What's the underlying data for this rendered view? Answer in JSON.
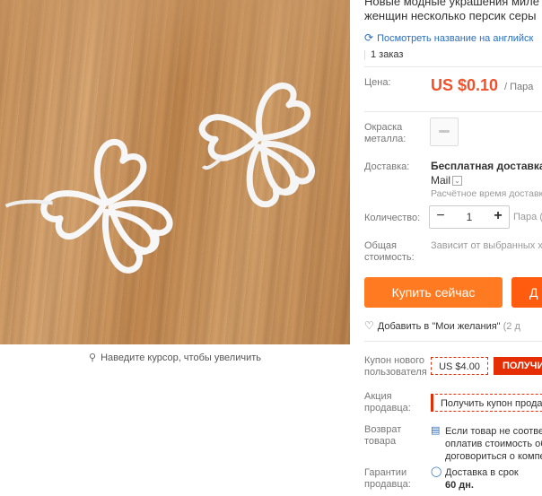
{
  "product": {
    "title_line1": "Новые модные украшения миле",
    "title_line2": "женщин несколько персик серы",
    "translate_link": "Посмотреть название на английск",
    "orders": "1 заказ"
  },
  "image": {
    "zoom_hint": "Наведите курсор, чтобы увеличить"
  },
  "price": {
    "label": "Цена:",
    "value": "US $0.10",
    "unit": "/ Пара"
  },
  "color": {
    "label_line1": "Окраска",
    "label_line2": "металла:"
  },
  "shipping": {
    "label": "Доставка:",
    "main": "Бесплатная доставка в",
    "method": "Mail",
    "estimate": "Расчётное время доставк"
  },
  "quantity": {
    "label": "Количество:",
    "minus": "−",
    "value": "1",
    "plus": "+",
    "unit": "Пара (",
    "aria": ""
  },
  "total": {
    "label_line1": "Общая",
    "label_line2": "стоимость:",
    "value": "Зависит от выбранных ха"
  },
  "actions": {
    "buy": "Купить сейчас",
    "cart": "Д"
  },
  "wishlist": {
    "text": "Добавить в \"Мои желания\"",
    "count": "(2 д"
  },
  "coupon": {
    "label_line1": "Купон нового",
    "label_line2": "пользователя",
    "amount": "US $4.00",
    "get": "ПОЛУЧИ"
  },
  "seller_promo": {
    "label_line1": "Акция",
    "label_line2": "продавца:",
    "button": "Получить купон прода"
  },
  "returns": {
    "label_line1": "Возврат",
    "label_line2": "товара",
    "line1": "Если товар не соответ",
    "line2": "оплатив стоимость об",
    "line3": "договориться о компе"
  },
  "guarantee": {
    "label_line1": "Гарантии",
    "label_line2": "продавца:",
    "line1": "Доставка в срок",
    "line2": "60 дн."
  },
  "colors": {
    "price": "#f0512b",
    "buy_button": "#ff7a21",
    "cart_button": "#ff5c0f",
    "coupon": "#e62e04",
    "link": "#2a6ebb"
  },
  "icons": [
    "translate-icon",
    "magnifier-icon",
    "heart-icon",
    "return-icon",
    "shield-icon",
    "chevron-down-icon"
  ]
}
